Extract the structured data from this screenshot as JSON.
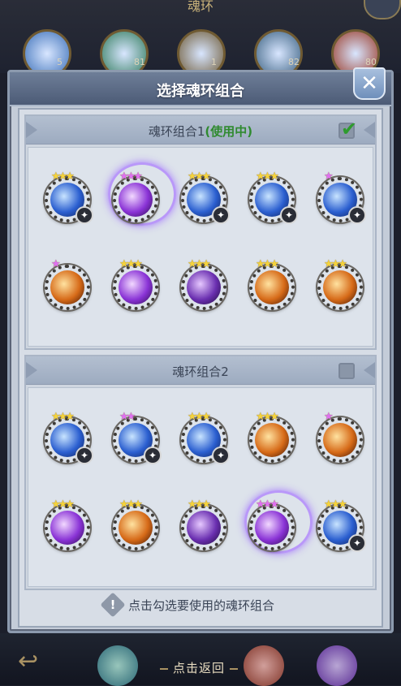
{
  "background": {
    "title": "魂环",
    "orbs": [
      {
        "count": "5",
        "color": "#3b6fb8"
      },
      {
        "count": "81",
        "color": "#2f7a5a"
      },
      {
        "count": "1",
        "color": "#6e5a36"
      },
      {
        "count": "82",
        "color": "#3a6080"
      },
      {
        "count": "80",
        "color": "#9a3a28"
      }
    ],
    "return_label": "点击返回"
  },
  "dialog": {
    "title": "选择魂环组合",
    "close_icon": "close-icon",
    "groups": [
      {
        "name": "魂环组合1",
        "status": "(使用中)",
        "checked": true,
        "rings": [
          {
            "color": "blue",
            "stars": "★★★",
            "star_color": "gold",
            "badge": true
          },
          {
            "color": "purple",
            "stars": "★★★",
            "star_color": "pink",
            "badge": false,
            "aura": true
          },
          {
            "color": "blue",
            "stars": "★★★",
            "star_color": "gold",
            "badge": true
          },
          {
            "color": "blue",
            "stars": "★★★",
            "star_color": "gold",
            "badge": true
          },
          {
            "color": "blue",
            "stars": "★",
            "star_color": "pink",
            "badge": true
          },
          {
            "color": "orange",
            "stars": "★",
            "star_color": "pink",
            "badge": false
          },
          {
            "color": "purple",
            "stars": "★★★",
            "star_color": "gold",
            "badge": false
          },
          {
            "color": "violet",
            "stars": "★★★",
            "star_color": "gold",
            "badge": false
          },
          {
            "color": "orange",
            "stars": "★★★",
            "star_color": "gold",
            "badge": false
          },
          {
            "color": "orange",
            "stars": "★★★",
            "star_color": "gold",
            "badge": false
          }
        ]
      },
      {
        "name": "魂环组合2",
        "status": "",
        "checked": false,
        "rings": [
          {
            "color": "blue",
            "stars": "★★★",
            "star_color": "gold",
            "badge": true
          },
          {
            "color": "blue",
            "stars": "★★",
            "star_color": "pink",
            "badge": true
          },
          {
            "color": "blue",
            "stars": "★★★",
            "star_color": "gold",
            "badge": true
          },
          {
            "color": "orange",
            "stars": "★★★",
            "star_color": "gold",
            "badge": false
          },
          {
            "color": "orange",
            "stars": "★",
            "star_color": "pink",
            "badge": false
          },
          {
            "color": "purple",
            "stars": "★★★",
            "star_color": "gold",
            "badge": false
          },
          {
            "color": "orange",
            "stars": "★★★",
            "star_color": "gold",
            "badge": false
          },
          {
            "color": "violet",
            "stars": "★★★",
            "star_color": "gold",
            "badge": false
          },
          {
            "color": "purple",
            "stars": "★★★",
            "star_color": "pink",
            "badge": false,
            "aura": true
          },
          {
            "color": "blue",
            "stars": "★★★",
            "star_color": "gold",
            "badge": true
          }
        ]
      }
    ],
    "hint": "点击勾选要使用的魂环组合",
    "hint_icon": "exclamation-icon"
  }
}
